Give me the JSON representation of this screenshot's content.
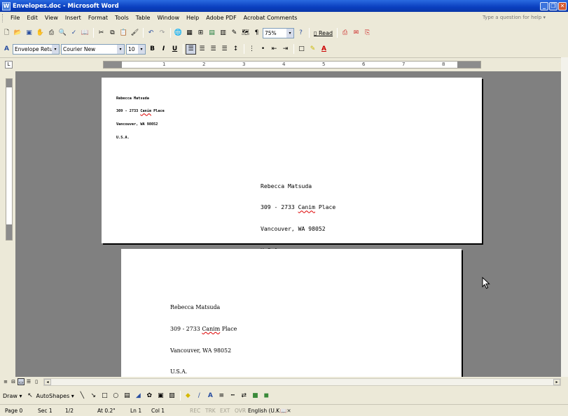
{
  "window": {
    "title": "Envelopes.doc - Microsoft Word",
    "app_icon": "W"
  },
  "menu": [
    "File",
    "Edit",
    "View",
    "Insert",
    "Format",
    "Tools",
    "Table",
    "Window",
    "Help",
    "Adobe PDF",
    "Acrobat Comments"
  ],
  "help_box": {
    "placeholder": "Type a question for help"
  },
  "toolbar_standard": {
    "zoom": "75%",
    "read_label": "Read"
  },
  "toolbar_formatting": {
    "style": "Envelope Retur",
    "font": "Courier New",
    "size": "10",
    "bold": "B",
    "italic": "I",
    "underline": "U"
  },
  "ruler": {
    "numbers": [
      "1",
      "2",
      "3",
      "4",
      "5",
      "6",
      "7",
      "8"
    ]
  },
  "envelope_1": {
    "return_address": [
      "Rebecca Matsuda",
      "309 - 2733 Canim Place",
      "Vancouver, WA 98052",
      "U.S.A."
    ],
    "delivery_address": [
      "Rebecca Matsuda",
      "309 - 2733 Canim Place",
      "Vancouver, WA 98052",
      "U.S.A."
    ]
  },
  "envelope_2": {
    "delivery_address": [
      "Rebecca Matsuda",
      "309 - 2733 Canim Place",
      "Vancouver, WA 98052",
      "U.S.A."
    ]
  },
  "drawing_toolbar": {
    "draw_label": "Draw",
    "autoshapes_label": "AutoShapes"
  },
  "status": {
    "page": "Page 0",
    "section": "Sec 1",
    "pages": "1/2",
    "at": "At 0.2\"",
    "line": "Ln 1",
    "col": "Col 1",
    "rec": "REC",
    "trk": "TRK",
    "ext": "EXT",
    "ovr": "OVR",
    "language": "English (U.K"
  },
  "colors": {
    "title_bar": "#0a3fbf",
    "canvas": "#808080",
    "chrome": "#ece9d8"
  }
}
